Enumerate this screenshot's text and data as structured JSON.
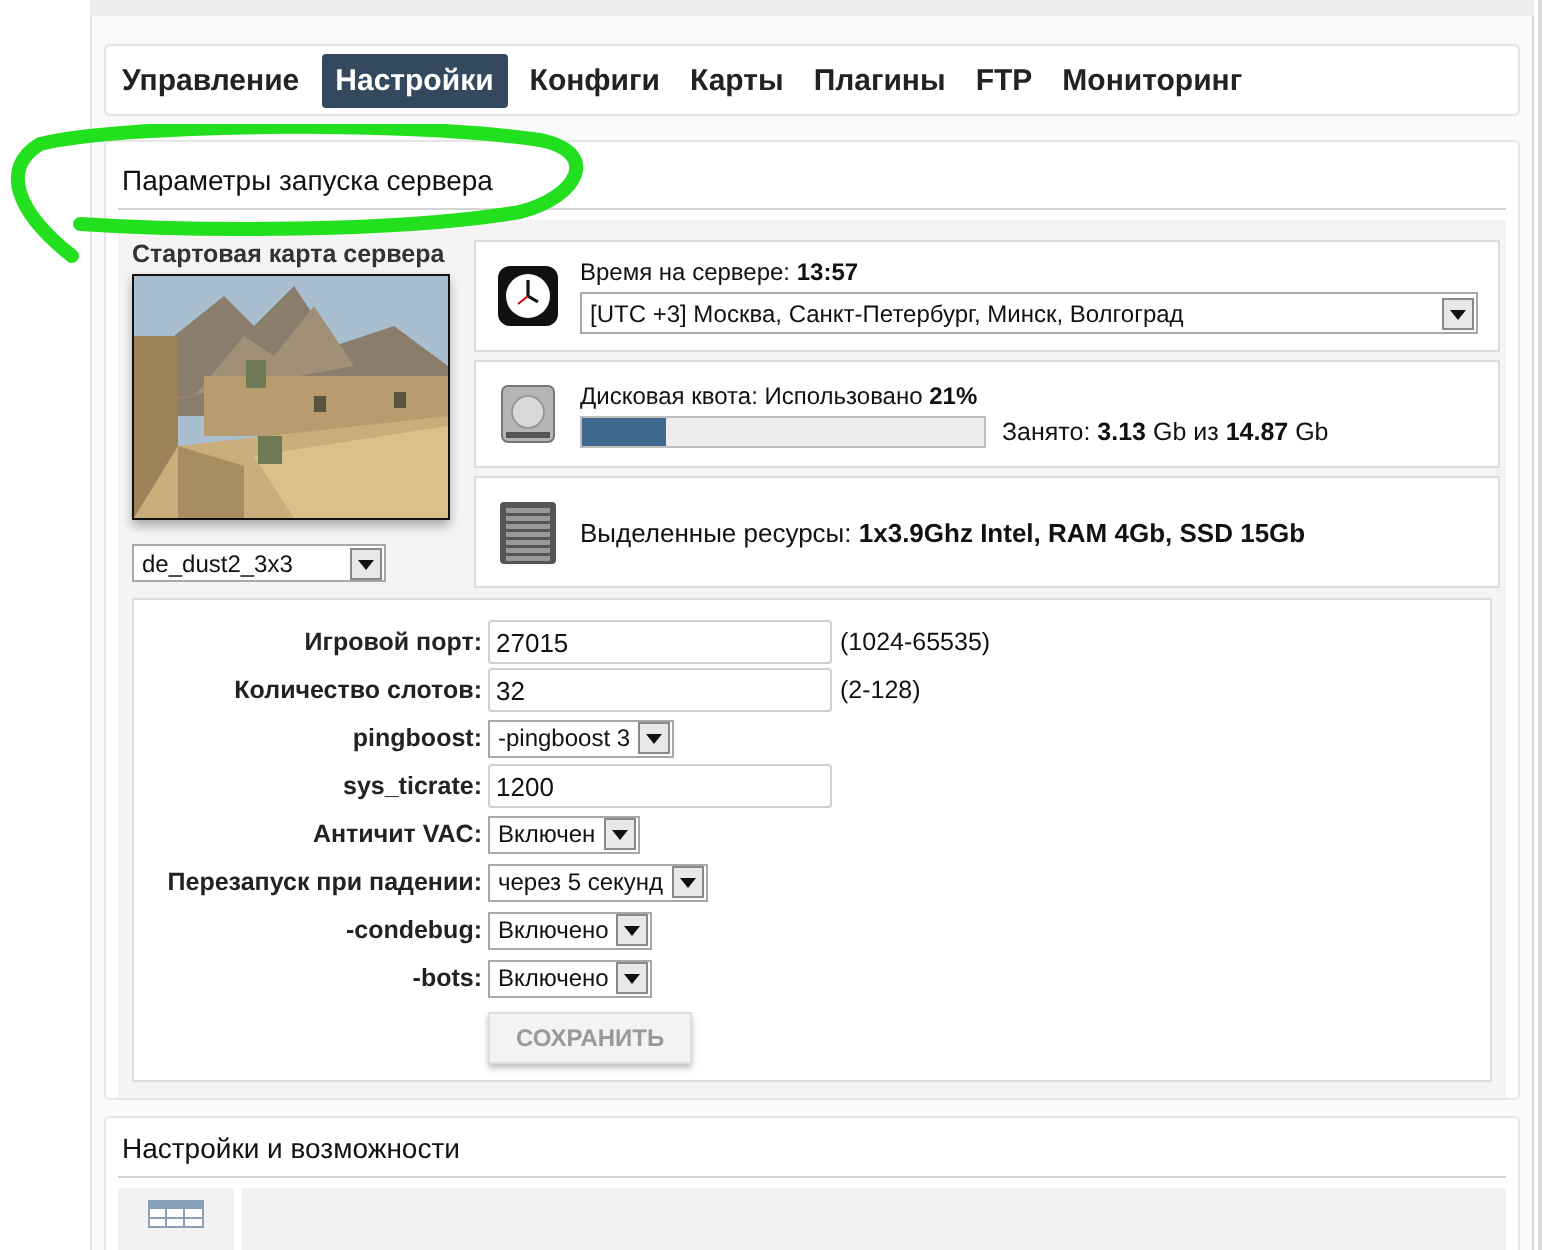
{
  "nav": {
    "tabs": [
      {
        "label": "Управление",
        "selected": false
      },
      {
        "label": "Настройки",
        "selected": true
      },
      {
        "label": "Конфиги",
        "selected": false
      },
      {
        "label": "Карты",
        "selected": false
      },
      {
        "label": "Плагины",
        "selected": false
      },
      {
        "label": "FTP",
        "selected": false
      },
      {
        "label": "Мониторинг",
        "selected": false
      }
    ]
  },
  "launch_section": {
    "title": "Параметры запуска сервера",
    "map": {
      "title": "Стартовая карта сервера",
      "value": "de_dust2_3x3"
    },
    "server_time": {
      "text": "Время на сервере: **13:57**",
      "timezone": "[UTC +3] Москва, Санкт-Петербург, Минск, Волгоград"
    },
    "disk": {
      "text": "Дисковая квота: Использовано **21%**",
      "level": 0.21,
      "usage": "Занято: **3.13** Gb из **14.87** Gb"
    },
    "resources": {
      "text": "Выделенные ресурсы: **1x3.9Ghz Intel, RAM 4Gb, SSD 15Gb**"
    },
    "form": {
      "fields": [
        {
          "kind": "input",
          "label": "Игровой порт:",
          "value": "27015",
          "hint": "(1024-65535)"
        },
        {
          "kind": "input",
          "label": "Количество слотов:",
          "value": "32",
          "hint": "(2-128)"
        },
        {
          "kind": "select",
          "label": "pingboost:",
          "value": "-pingboost 3"
        },
        {
          "kind": "input",
          "label": "sys_ticrate:",
          "value": "1200"
        },
        {
          "kind": "select",
          "label": "Античит VAC:",
          "value": "Включен"
        },
        {
          "kind": "select",
          "label": "Перезапуск при падении:",
          "value": "через 5 секунд"
        },
        {
          "kind": "select",
          "label": "-condebug:",
          "value": "Включено"
        },
        {
          "kind": "select",
          "label": "-bots:",
          "value": "Включено"
        }
      ],
      "save_button": {
        "label": "СОХРАНИТЬ",
        "disabled": true
      }
    }
  },
  "features_section": {
    "title": "Настройки и возможности"
  }
}
